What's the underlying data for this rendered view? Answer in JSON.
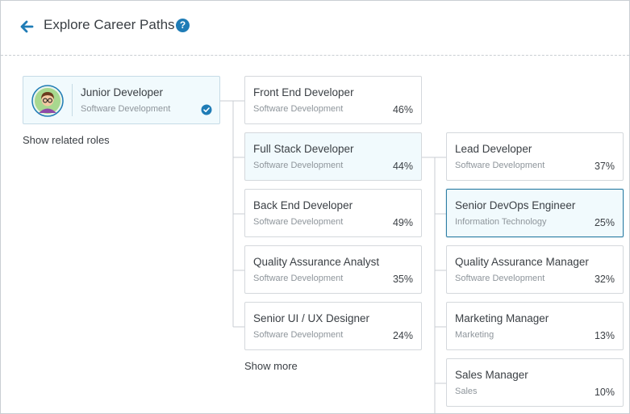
{
  "header": {
    "title": "Explore Career Paths"
  },
  "current_role": {
    "title": "Junior Developer",
    "category": "Software Development"
  },
  "related_roles_link": "Show related roles",
  "column1": {
    "roles": [
      {
        "title": "Front End Developer",
        "category": "Software Development",
        "match": "46%"
      },
      {
        "title": "Full Stack Developer",
        "category": "Software Development",
        "match": "44%"
      },
      {
        "title": "Back End Developer",
        "category": "Software Development",
        "match": "49%"
      },
      {
        "title": "Quality Assurance Analyst",
        "category": "Software Development",
        "match": "35%"
      },
      {
        "title": "Senior UI / UX Designer",
        "category": "Software Development",
        "match": "24%"
      }
    ],
    "show_more": "Show more"
  },
  "column2": {
    "roles": [
      {
        "title": "Lead Developer",
        "category": "Software Development",
        "match": "37%"
      },
      {
        "title": "Senior DevOps Engineer",
        "category": "Information Technology",
        "match": "25%"
      },
      {
        "title": "Quality Assurance Manager",
        "category": "Software Development",
        "match": "32%"
      },
      {
        "title": "Marketing Manager",
        "category": "Marketing",
        "match": "13%"
      },
      {
        "title": "Sales Manager",
        "category": "Sales",
        "match": "10%"
      }
    ]
  },
  "colors": {
    "accent": "#1f7cb6",
    "selected_border": "#2e7fa5",
    "highlight_bg": "#f1fafd"
  }
}
